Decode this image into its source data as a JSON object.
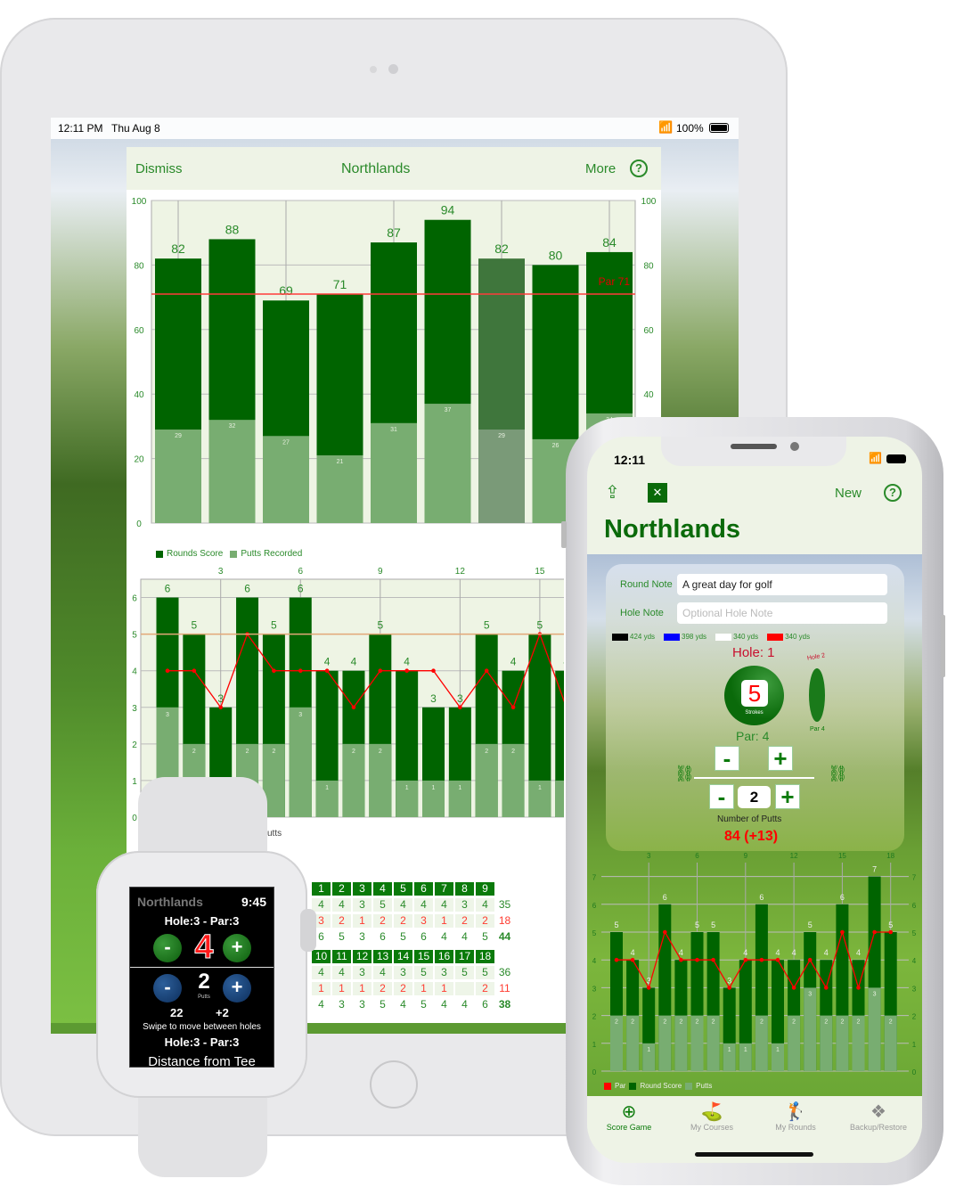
{
  "ipad": {
    "status": {
      "time": "12:11 PM",
      "date": "Thu Aug 8",
      "battery": "100%"
    },
    "header": {
      "dismiss": "Dismiss",
      "title": "Northlands",
      "more": "More",
      "help_icon": "question-circle"
    },
    "legend": [
      {
        "label": "Rounds Score",
        "color": "#006400"
      },
      {
        "label": "Putts Recorded",
        "color": "#78ad71"
      }
    ],
    "hole_chart_legend_fragment": "utts"
  },
  "scorecard": {
    "front": {
      "holes": [
        "1",
        "2",
        "3",
        "4",
        "5",
        "6",
        "7",
        "8",
        "9"
      ],
      "par": [
        "4",
        "4",
        "3",
        "5",
        "4",
        "4",
        "4",
        "3",
        "4"
      ],
      "par_total": "35",
      "putts": [
        "3",
        "2",
        "1",
        "2",
        "2",
        "3",
        "1",
        "2",
        "2"
      ],
      "putts_total": "18",
      "score": [
        "6",
        "5",
        "3",
        "6",
        "5",
        "6",
        "4",
        "4",
        "5"
      ],
      "score_total": "44"
    },
    "back": {
      "holes": [
        "10",
        "11",
        "12",
        "13",
        "14",
        "15",
        "16",
        "17",
        "18"
      ],
      "par": [
        "4",
        "4",
        "3",
        "4",
        "3",
        "5",
        "3",
        "5",
        "5"
      ],
      "par_total": "36",
      "putts": [
        "1",
        "1",
        "1",
        "2",
        "2",
        "1",
        "1",
        "",
        "2"
      ],
      "putts_total": "11",
      "score": [
        "4",
        "3",
        "3",
        "5",
        "4",
        "5",
        "4",
        "4",
        "6"
      ],
      "score_total": "38"
    }
  },
  "watch": {
    "course": "Northlands",
    "time": "9:45",
    "hole_par": "Hole:3 - Par:3",
    "strokes": "4",
    "minus": "-",
    "plus": "+",
    "putts": "2",
    "putts_label": "Putts",
    "total": "22",
    "over_par": "+2",
    "swipe_hint": "Swipe to move between holes",
    "hole_par_2": "Hole:3 - Par:3",
    "distance_label": "Distance from Tee"
  },
  "iphone": {
    "time": "12:11",
    "toolbar": {
      "new": "New",
      "share_icon": "share",
      "logo_icon": "golf-logo",
      "help_icon": "question-circle"
    },
    "title": "Northlands",
    "round_note_label": "Round Note",
    "round_note_value": "A great day for golf",
    "hole_note_label": "Hole Note",
    "hole_note_placeholder": "Optional Hole Note",
    "tees": [
      {
        "color": "#000000",
        "label": "424 yds"
      },
      {
        "color": "#0000ff",
        "label": "398 yds"
      },
      {
        "color": "#ffffff",
        "label": "340 yds"
      },
      {
        "color": "#ff0000",
        "label": "340 yds"
      }
    ],
    "hole_label": "Hole: 1",
    "strokes": "5",
    "strokes_caption": "Strokes",
    "next_hole": "Hole 2",
    "next_par": "Par 4",
    "par_label": "Par: 4",
    "minus": "-",
    "plus": "+",
    "putts": "2",
    "putts_label": "Number of Putts",
    "total": "84 (+13)",
    "tabs": [
      {
        "label": "Score Game",
        "icon": "golf-ball-plus",
        "active": true
      },
      {
        "label": "My Courses",
        "icon": "flag-green"
      },
      {
        "label": "My Rounds",
        "icon": "golfer"
      },
      {
        "label": "Backup/Restore",
        "icon": "dropbox"
      }
    ]
  },
  "chart_data": [
    {
      "type": "bar",
      "mode": "overlay",
      "series": [
        {
          "name": "Rounds Score",
          "values": [
            82,
            88,
            69,
            71,
            87,
            94,
            82,
            80,
            84
          ],
          "color": "#006400"
        },
        {
          "name": "Putts Recorded",
          "values": [
            29,
            32,
            27,
            21,
            31,
            37,
            29,
            26,
            34
          ],
          "color": "#78ad71"
        }
      ],
      "highlighted_index": 6,
      "highlight_colors": [
        "#3f763c",
        "#7a9a78"
      ],
      "ylim": [
        0,
        100
      ],
      "yticks": [
        "0",
        "20",
        "40",
        "60",
        "80",
        "100"
      ],
      "reference_line": {
        "label": "Par 71",
        "value": 71,
        "color": "#ff3b3b"
      },
      "grid": true,
      "legend": "bottom-left"
    },
    {
      "type": "bar",
      "mode": "overlay",
      "x": [
        1,
        2,
        3,
        4,
        5,
        6,
        7,
        8,
        9,
        10,
        11,
        12,
        13,
        14,
        15,
        16
      ],
      "xticks": [
        "3",
        "6",
        "9",
        "12",
        "15"
      ],
      "series": [
        {
          "values": [
            6,
            5,
            3,
            6,
            5,
            6,
            4,
            4,
            5,
            4,
            3,
            3,
            5,
            4,
            5,
            4
          ],
          "color": "#006400"
        },
        {
          "values": [
            3,
            2,
            1,
            2,
            2,
            3,
            1,
            2,
            2,
            1,
            1,
            1,
            2,
            2,
            1,
            1
          ],
          "color": "#78ad71"
        },
        {
          "type": "line",
          "values": [
            4,
            4,
            3,
            5,
            4,
            4,
            4,
            3,
            4,
            4,
            4,
            3,
            4,
            3,
            5,
            3
          ],
          "color": "#ff0000"
        }
      ],
      "ylim": [
        0,
        6.5
      ],
      "yticks": [
        "0",
        "1",
        "2",
        "3",
        "4",
        "5",
        "6"
      ],
      "reference_line": {
        "value": 5,
        "color": "#e3a878"
      },
      "grid": true
    },
    {
      "type": "bar",
      "mode": "overlay",
      "x": [
        1,
        2,
        3,
        4,
        5,
        6,
        7,
        8,
        9,
        10,
        11,
        12,
        13,
        14,
        15,
        16,
        17,
        18
      ],
      "xticks": [
        "3",
        "6",
        "9",
        "12",
        "15",
        "18"
      ],
      "series": [
        {
          "name": "Par",
          "type": "line",
          "values": [
            4,
            4,
            3,
            5,
            4,
            4,
            4,
            3,
            4,
            4,
            4,
            3,
            4,
            3,
            5,
            3,
            5,
            5
          ],
          "color": "#ff0000"
        },
        {
          "name": "Round Score",
          "values": [
            5,
            4,
            3,
            6,
            4,
            5,
            5,
            3,
            4,
            6,
            4,
            4,
            5,
            4,
            6,
            4,
            7,
            5
          ],
          "color": "#006400"
        },
        {
          "name": "Putts",
          "values": [
            2,
            2,
            1,
            2,
            2,
            2,
            2,
            1,
            1,
            2,
            1,
            2,
            3,
            2,
            2,
            2,
            3,
            2
          ],
          "color": "#78ad71"
        }
      ],
      "ylim": [
        0,
        7.5
      ],
      "yticks": [
        "0",
        "1",
        "2",
        "3",
        "4",
        "5",
        "6",
        "7"
      ],
      "grid": true,
      "legend": "bottom-left"
    }
  ]
}
